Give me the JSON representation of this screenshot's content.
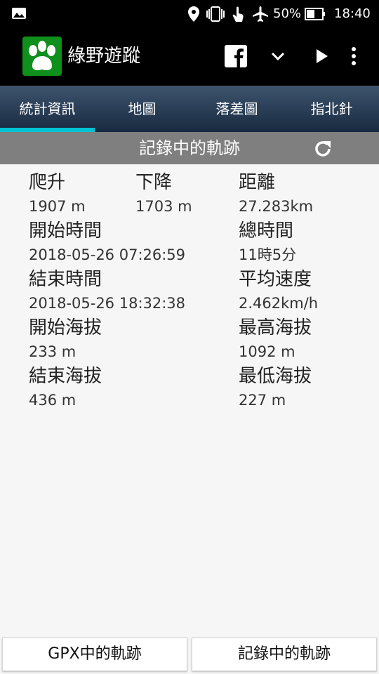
{
  "status_bar": {
    "battery": "50%",
    "time": "18:40",
    "icons": [
      "image-icon",
      "location-icon",
      "vibrate-icon",
      "touch-icon",
      "airplane-icon",
      "battery-icon"
    ]
  },
  "app_bar": {
    "title": "綠野遊蹤",
    "actions": [
      "facebook-icon",
      "chevron-down-icon",
      "play-icon",
      "more-vert-icon"
    ]
  },
  "tabs": [
    {
      "label": "統計資訊",
      "active": true
    },
    {
      "label": "地圖",
      "active": false
    },
    {
      "label": "落差圖",
      "active": false
    },
    {
      "label": "指北針",
      "active": false
    }
  ],
  "section_header": {
    "title": "記錄中的軌跡"
  },
  "stats": {
    "ascent": {
      "label": "爬升",
      "value": "1907 m"
    },
    "descent": {
      "label": "下降",
      "value": "1703 m"
    },
    "distance": {
      "label": "距離",
      "value": "27.283km"
    },
    "start_time": {
      "label": "開始時間",
      "value": "2018-05-26 07:26:59"
    },
    "total_time": {
      "label": "總時間",
      "value": "11時5分"
    },
    "end_time": {
      "label": "結束時間",
      "value": "2018-05-26 18:32:38"
    },
    "avg_speed": {
      "label": "平均速度",
      "value": "2.462km/h"
    },
    "start_altitude": {
      "label": "開始海拔",
      "value": "233 m"
    },
    "max_altitude": {
      "label": "最高海拔",
      "value": "1092 m"
    },
    "end_altitude": {
      "label": "結束海拔",
      "value": "436 m"
    },
    "min_altitude": {
      "label": "最低海拔",
      "value": "227 m"
    }
  },
  "bottom_buttons": {
    "gpx": "GPX中的軌跡",
    "recording": "記錄中的軌跡"
  },
  "colors": {
    "tab_indicator": "#00c4d4",
    "logo_green": "#0f8f1b",
    "header_gray": "#7f7f7f"
  }
}
